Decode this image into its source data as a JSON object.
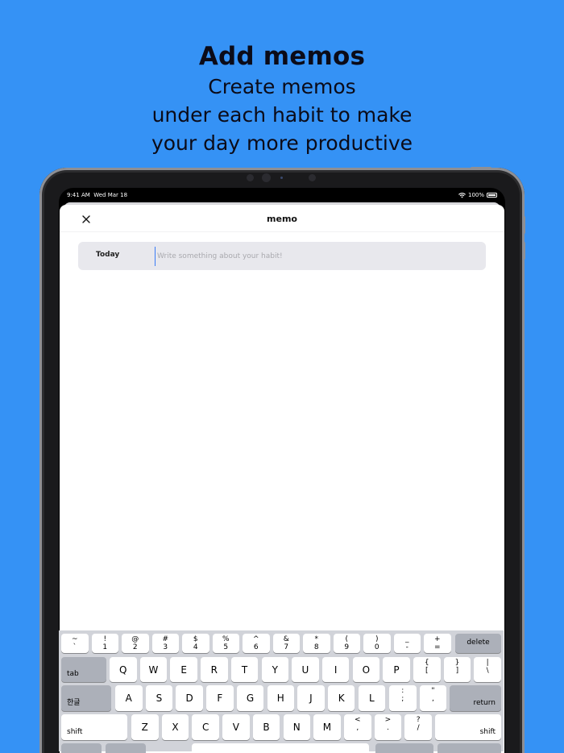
{
  "headline": {
    "title": "Add memos",
    "line1": "Create memos",
    "line2": "under each habit to make",
    "line3": "your day more productive"
  },
  "status_bar": {
    "time": "9:41 AM",
    "date": "Wed Mar 18",
    "battery": "100%"
  },
  "nav": {
    "title": "memo",
    "close_icon": "close-icon"
  },
  "memo_entry": {
    "date_label": "Today",
    "placeholder": "Write something about your habit!",
    "value": ""
  },
  "keyboard": {
    "number_row": [
      {
        "top": "~",
        "bottom": "`"
      },
      {
        "top": "!",
        "bottom": "1"
      },
      {
        "top": "@",
        "bottom": "2"
      },
      {
        "top": "#",
        "bottom": "3"
      },
      {
        "top": "$",
        "bottom": "4"
      },
      {
        "top": "%",
        "bottom": "5"
      },
      {
        "top": "^",
        "bottom": "6"
      },
      {
        "top": "&",
        "bottom": "7"
      },
      {
        "top": "*",
        "bottom": "8"
      },
      {
        "top": "(",
        "bottom": "9"
      },
      {
        "top": ")",
        "bottom": "0"
      },
      {
        "top": "_",
        "bottom": "-"
      },
      {
        "top": "+",
        "bottom": "="
      }
    ],
    "delete_label": "delete",
    "tab_label": "tab",
    "row_q": [
      "Q",
      "W",
      "E",
      "R",
      "T",
      "Y",
      "U",
      "I",
      "O",
      "P"
    ],
    "bracket_keys": [
      {
        "top": "{",
        "bottom": "["
      },
      {
        "top": "}",
        "bottom": "]"
      },
      {
        "top": "|",
        "bottom": "\\"
      }
    ],
    "lang_label": "한글",
    "row_a": [
      "A",
      "S",
      "D",
      "F",
      "G",
      "H",
      "J",
      "K",
      "L"
    ],
    "punct_keys_a": [
      {
        "top": ":",
        "bottom": ";"
      },
      {
        "top": "\"",
        "bottom": ","
      }
    ],
    "return_label": "return",
    "shift_label": "shift",
    "row_z": [
      "Z",
      "X",
      "C",
      "V",
      "B",
      "N",
      "M"
    ],
    "punct_keys_z": [
      {
        "top": "<",
        "bottom": ","
      },
      {
        "top": ">",
        "bottom": "."
      },
      {
        "top": "?",
        "bottom": "/"
      }
    ]
  }
}
